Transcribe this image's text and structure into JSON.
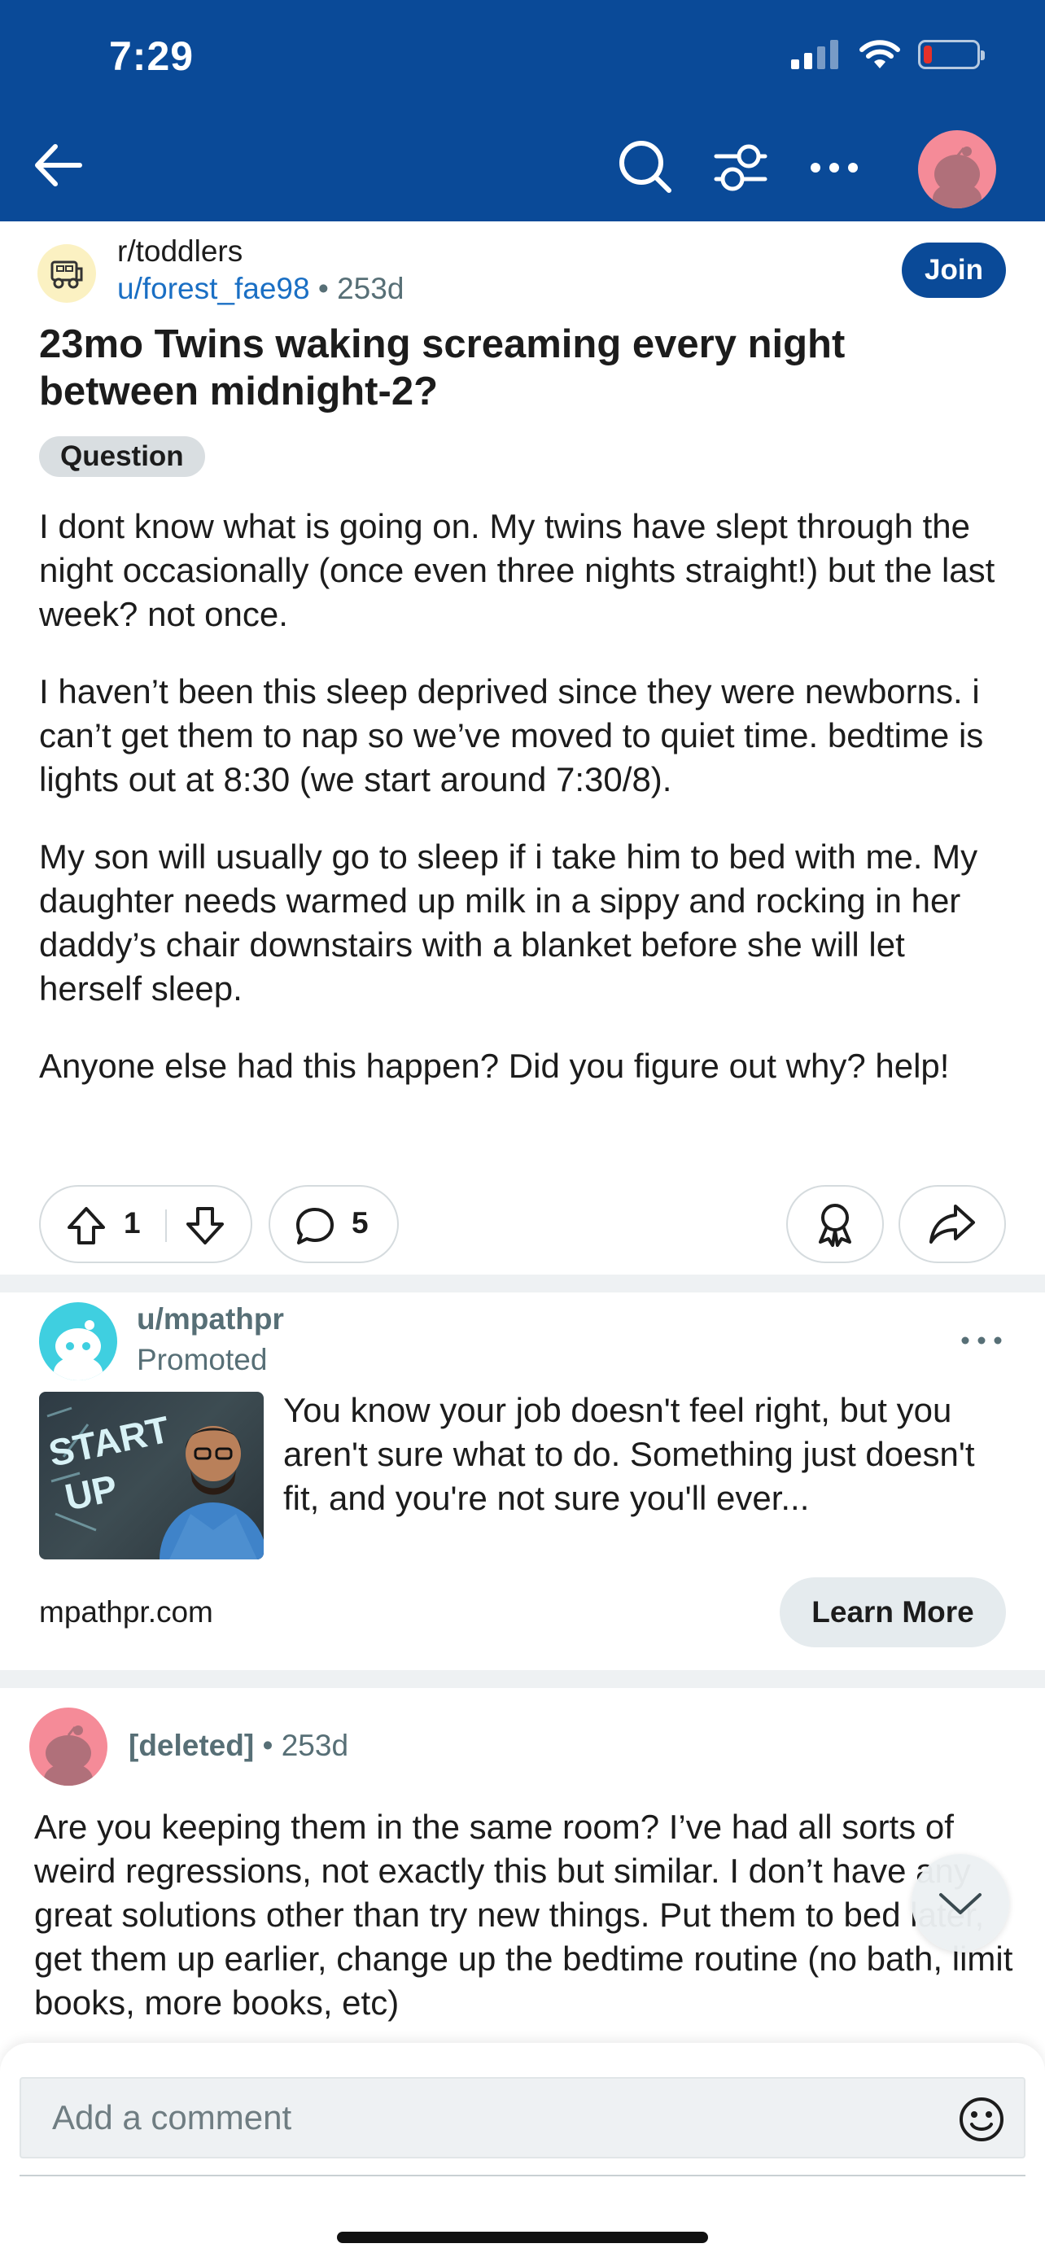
{
  "status_bar": {
    "time": "7:29"
  },
  "colors": {
    "header": "#0a4a98",
    "join": "#0a4a98",
    "link": "#1a6fc4",
    "battery_low": "#e5312a"
  },
  "icons": [
    "back-arrow-icon",
    "search-icon",
    "filter-icon",
    "more-icon",
    "avatar",
    "subreddit-icon",
    "upvote-icon",
    "downvote-icon",
    "comment-icon",
    "award-icon",
    "share-icon",
    "chevron-down-icon",
    "emoji-icon"
  ],
  "post": {
    "subreddit": "r/toddlers",
    "author": "u/forest_fae98",
    "separator": "•",
    "age": "253d",
    "join_label": "Join",
    "title": "23mo Twins waking screaming every night between midnight-2?",
    "flair": "Question",
    "paragraphs": [
      "I dont know what is going on. My twins have slept through the night occasionally (once even three nights straight!) but the last week? not once.",
      "I haven’t been this sleep deprived since they were newborns. i can’t get them to nap so we’ve moved to quiet time. bedtime is lights out at 8:30 (we start around 7:30/8).",
      "My son will usually go to sleep if i take him to bed with me. My daughter needs warmed up milk in a sippy and rocking in her daddy’s chair downstairs with a blanket before she will let herself sleep.",
      "Anyone else had this happen? Did you figure out why? help!"
    ],
    "votes": "1",
    "comments": "5"
  },
  "ad": {
    "user": "u/mpathpr",
    "promoted_label": "Promoted",
    "text": "You know your job doesn't feel right, but you aren't sure what to do. Something just doesn't fit, and you're not sure you'll ever...",
    "domain": "mpathpr.com",
    "cta": "Learn More",
    "image_text": "START UP"
  },
  "comment": {
    "user": "[deleted]",
    "separator": "•",
    "age": "253d",
    "text": "Are you keeping them in the same room? I’ve had all sorts of weird regressions, not exactly this but similar. I don’t have any great solutions other than try new things. Put them to bed later, get them up earlier, change up the bedtime routine (no bath, limit books, more books, etc)"
  },
  "composer": {
    "placeholder": "Add a comment"
  }
}
